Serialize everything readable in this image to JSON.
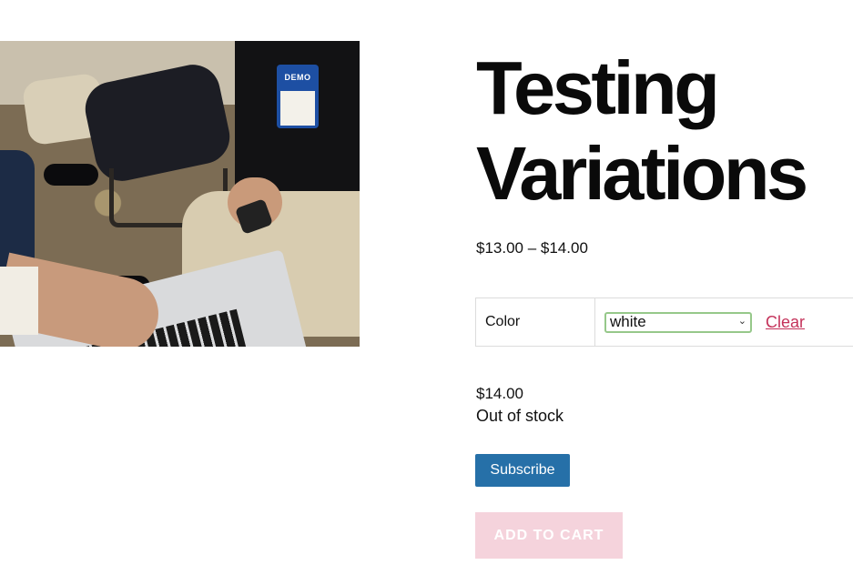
{
  "product": {
    "title_line1": "Testing",
    "title_line2": "Variations",
    "price_range": "$13.00 – $14.00",
    "image": {
      "badge_text": "DEMO"
    }
  },
  "variations": {
    "color_label": "Color",
    "color_selected": "white",
    "clear_label": "Clear"
  },
  "selected_variation": {
    "price": "$14.00",
    "stock_status": "Out of stock"
  },
  "actions": {
    "subscribe_label": "Subscribe",
    "add_to_cart_label": "ADD TO CART"
  },
  "colors": {
    "subscribe_bg": "#2670a8",
    "add_to_cart_bg_disabled": "#f5d3dc",
    "clear_link": "#c4325a",
    "select_border": "#96c88a"
  }
}
